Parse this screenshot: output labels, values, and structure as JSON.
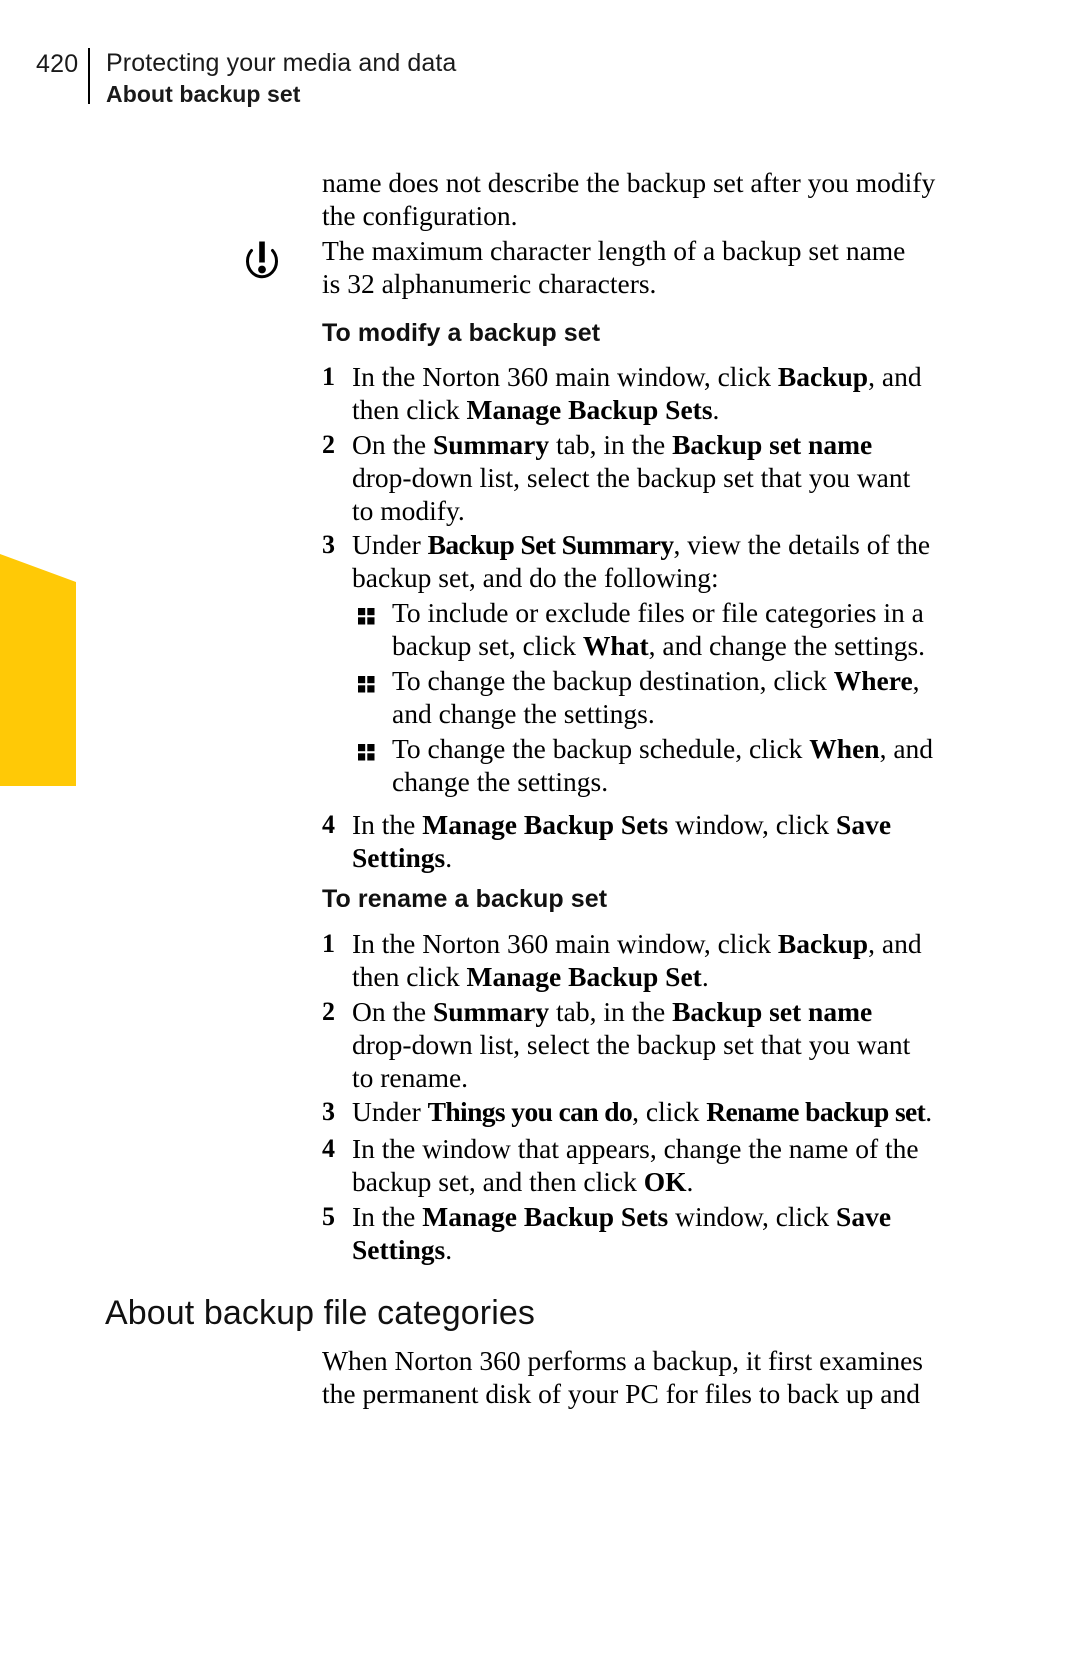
{
  "header": {
    "folio": "420",
    "chapter": "Protecting your media and data",
    "section": "About backup set"
  },
  "colors": {
    "thumb_tab": "#ffc906",
    "text": "#000000"
  },
  "icons": {
    "note": "exclamation-in-circle-icon",
    "bullet": "quad-square-bullet-icon"
  },
  "body": {
    "intro_para": {
      "line1": "name does not describe the backup set after you modify",
      "line2": "the configuration."
    },
    "note_para": {
      "line1": "The maximum character length of a backup set name",
      "line2": "is 32 alphanumeric characters."
    },
    "modify_heading": "To modify a backup set",
    "modify_steps": [
      {
        "num": "1",
        "line1_a": "In the Norton 360 main window, click ",
        "line1_b": "Backup",
        "line1_c": ", and",
        "line2_a": "then click ",
        "line2_b": "Manage Backup Sets",
        "line2_c": "."
      },
      {
        "num": "2",
        "line1_a": "On the ",
        "line1_b": "Summary",
        "line1_c": " tab, in the ",
        "line1_d": "Backup set name",
        "line2": "drop-down list, select the backup set that you want",
        "line3": "to modify."
      },
      {
        "num": "3",
        "line1_a": "Under ",
        "line1_b": "Backup Set Summary",
        "line1_c": ", view the details of the",
        "line2": "backup set, and do the following:"
      }
    ],
    "modify_bullets": [
      {
        "line1": "To include or exclude files or file categories in a",
        "line2_a": "backup set, click ",
        "line2_b": "What",
        "line2_c": ", and change the settings."
      },
      {
        "line1_a": "To change the backup destination, click ",
        "line1_b": "Where",
        "line1_c": ",",
        "line2": "and change the settings."
      },
      {
        "line1_a": "To change the backup schedule, click ",
        "line1_b": "When",
        "line1_c": ", and",
        "line2": "change the settings."
      }
    ],
    "modify_step4": {
      "num": "4",
      "line1_a": "In the ",
      "line1_b": "Manage Backup Sets",
      "line1_c": " window, click ",
      "line1_d": "Save",
      "line2_b": "Settings",
      "line2_c": "."
    },
    "rename_heading": "To rename a backup set",
    "rename_steps": [
      {
        "num": "1",
        "line1_a": "In the Norton 360 main window, click ",
        "line1_b": "Backup",
        "line1_c": ", and",
        "line2_a": "then click ",
        "line2_b": "Manage Backup Set",
        "line2_c": "."
      },
      {
        "num": "2",
        "line1_a": "On the ",
        "line1_b": "Summary",
        "line1_c": " tab, in the ",
        "line1_d": "Backup set name",
        "line2": "drop-down list, select the backup set that you want",
        "line3": "to rename."
      },
      {
        "num": "3",
        "line1_a": "Under ",
        "line1_b": "Things you can do",
        "line1_c": ", click ",
        "line1_d": "Rename backup set",
        "line1_e": "."
      },
      {
        "num": "4",
        "line1": "In the window that appears, change the name of the",
        "line2_a": "backup set, and then click ",
        "line2_b": "OK",
        "line2_c": "."
      },
      {
        "num": "5",
        "line1_a": "In the ",
        "line1_b": "Manage Backup Sets",
        "line1_c": " window, click ",
        "line1_d": "Save",
        "line2_b": "Settings",
        "line2_c": "."
      }
    ],
    "categories_heading": "About backup file categories",
    "categories_para": {
      "line1": "When Norton 360 performs a backup, it first examines",
      "line2": "the permanent disk of your PC for files to back up and"
    }
  }
}
